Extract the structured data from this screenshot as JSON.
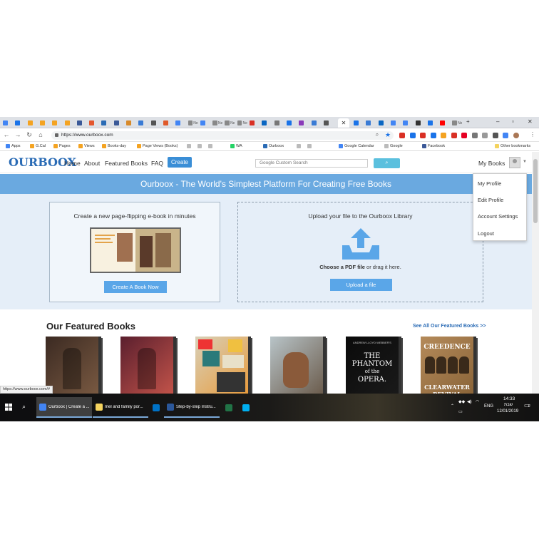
{
  "browser": {
    "tabs": [
      {
        "title": "",
        "color": "#4285f4"
      },
      {
        "title": "",
        "color": "#1a73e8"
      },
      {
        "title": "",
        "color": "#f4a321"
      },
      {
        "title": "",
        "color": "#f4a321"
      },
      {
        "title": "",
        "color": "#f4a321"
      },
      {
        "title": "",
        "color": "#f4a321"
      },
      {
        "title": "",
        "color": "#3b5998"
      },
      {
        "title": "",
        "color": "#e4572e"
      },
      {
        "title": "",
        "color": "#2a6bb5"
      },
      {
        "title": "",
        "color": "#3b5998"
      },
      {
        "title": "",
        "color": "#d88a2a"
      },
      {
        "title": "",
        "color": "#3a7bd5"
      },
      {
        "title": "",
        "color": "#555555"
      },
      {
        "title": "",
        "color": "#e05a2b"
      },
      {
        "title": "",
        "color": "#4285f4"
      },
      {
        "title": "Ne",
        "color": "#888888"
      },
      {
        "title": "",
        "color": "#4285f4"
      },
      {
        "title": "Ne",
        "color": "#888888"
      },
      {
        "title": "Ne",
        "color": "#888888"
      },
      {
        "title": "Ne",
        "color": "#888888"
      },
      {
        "title": "",
        "color": "#d93025"
      },
      {
        "title": "",
        "color": "#0a66c2"
      },
      {
        "title": "",
        "color": "#777777"
      },
      {
        "title": "",
        "color": "#1a73e8"
      },
      {
        "title": "",
        "color": "#8a3ab9"
      },
      {
        "title": "",
        "color": "#3a7bd5"
      },
      {
        "title": "",
        "color": "#555555"
      }
    ],
    "tabs_right": [
      {
        "title": "",
        "color": "#1a73e8"
      },
      {
        "title": "",
        "color": "#3a7bd5"
      },
      {
        "title": "",
        "color": "#0a66c2"
      },
      {
        "title": "",
        "color": "#4285f4"
      },
      {
        "title": "",
        "color": "#4285f4"
      },
      {
        "title": "",
        "color": "#333333"
      },
      {
        "title": "",
        "color": "#1a73e8"
      },
      {
        "title": "",
        "color": "#ff0000"
      },
      {
        "title": "Ne",
        "color": "#888888"
      }
    ],
    "url": "https://www.ourboox.com",
    "bookmarks": [
      {
        "label": "Apps",
        "color": "#4285f4"
      },
      {
        "label": "G.Cal",
        "color": "#f4a321"
      },
      {
        "label": "Pages",
        "color": "#f4a321"
      },
      {
        "label": "Views",
        "color": "#f4a321"
      },
      {
        "label": "Books-day",
        "color": "#f4a321"
      },
      {
        "label": "Page Views (Books)",
        "color": "#f4a321"
      },
      {
        "label": "",
        "color": "#bbbbbb"
      },
      {
        "label": "",
        "color": "#bbbbbb"
      },
      {
        "label": "",
        "color": "#bbbbbb"
      },
      {
        "label": "WA",
        "color": "#25d366"
      },
      {
        "label": "Ourboox",
        "color": "#2a6bb5"
      },
      {
        "label": "",
        "color": "#bbbbbb"
      },
      {
        "label": "",
        "color": "#bbbbbb"
      },
      {
        "label": "Google Calendar",
        "color": "#4285f4"
      },
      {
        "label": "Google",
        "color": "#bbbbbb"
      },
      {
        "label": "Facebook",
        "color": "#3b5998"
      },
      {
        "label": "Other bookmarks",
        "color": "#f4d35e"
      }
    ],
    "status_url": "https://www.ourboox.com/#"
  },
  "site": {
    "logo": "OURBOOX",
    "nav": {
      "home": "Home",
      "about": "About",
      "featured": "Featured Books",
      "faq": "FAQ",
      "create": "Create"
    },
    "search_placeholder": "Google Custom Search",
    "my_books": "My Books",
    "banner": "Ourboox - The World's Simplest Platform For Creating Free Books",
    "hero": {
      "create_title": "Create a new page-flipping e-book in minutes",
      "create_button": "Create A Book Now",
      "upload_title": "Upload your file to the Ourboox Library",
      "choose_bold": "Choose a PDF file",
      "choose_rest": " or drag it here.",
      "upload_button": "Upload a file"
    },
    "featured_title": "Our Featured Books",
    "see_all": "See All Our Featured Books >>",
    "books": [
      {
        "name": "book-cover-1",
        "colors": [
          "#3b2a22",
          "#7a5a42"
        ]
      },
      {
        "name": "book-cover-2",
        "colors": [
          "#5a1f2e",
          "#c4544a"
        ]
      },
      {
        "name": "book-cover-3",
        "colors": [
          "#d8d0b8",
          "#e89a3a"
        ]
      },
      {
        "name": "book-cover-4",
        "colors": [
          "#b8c4c8",
          "#6a5a4a"
        ]
      },
      {
        "name": "book-cover-phantom",
        "colors": [
          "#0a0a0a",
          "#1a1a1a"
        ],
        "author": "ANDREW LLOYD WEBBER'S",
        "title_lines": [
          "THE",
          "PHANTOM",
          "of the",
          "OPERA."
        ]
      },
      {
        "name": "book-cover-creedence",
        "colors": [
          "#b48a5a",
          "#8a6438"
        ],
        "title": "CREEDENCE",
        "bottom": "CLEARWATER REVIVAL"
      }
    ],
    "menu": [
      "My Profile",
      "Edit Profile",
      "Account Settings",
      "Logout"
    ]
  },
  "taskbar": {
    "items": [
      {
        "label": "Ourboox | Create a ...",
        "color": "#4285f4",
        "active": true
      },
      {
        "label": "mel and family por...",
        "color": "#f4d35e",
        "active": false
      },
      {
        "label": "",
        "color": "#0072c6",
        "active": false
      },
      {
        "label": "Step-by-step Instru...",
        "color": "#2b579a",
        "active": false
      },
      {
        "label": "",
        "color": "#217346",
        "active": false
      },
      {
        "label": "",
        "color": "#00aff0",
        "active": false
      }
    ],
    "lang": "ENG",
    "time": "14:33",
    "day": "שבת",
    "date": "12/01/2019",
    "notifications": "2"
  }
}
